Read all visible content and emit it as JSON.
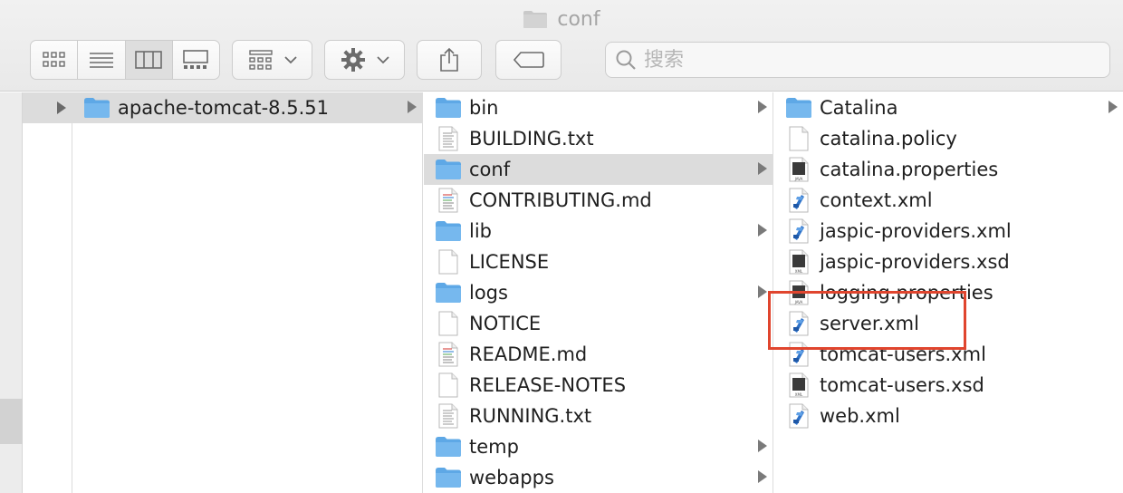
{
  "window": {
    "title": "conf"
  },
  "toolbar": {
    "view_modes": [
      "icon-view",
      "list-view",
      "column-view",
      "gallery-view"
    ],
    "active_view": "column-view",
    "search_placeholder": "搜索"
  },
  "columns": [
    {
      "items": [
        {
          "name": "apache-tomcat-8.5.51",
          "type": "folder",
          "has_children": true,
          "selected": true
        }
      ]
    },
    {
      "items": [
        {
          "name": "bin",
          "type": "folder",
          "has_children": true
        },
        {
          "name": "BUILDING.txt",
          "type": "text"
        },
        {
          "name": "conf",
          "type": "folder",
          "has_children": true,
          "selected": true
        },
        {
          "name": "CONTRIBUTING.md",
          "type": "md"
        },
        {
          "name": "lib",
          "type": "folder",
          "has_children": true
        },
        {
          "name": "LICENSE",
          "type": "blank"
        },
        {
          "name": "logs",
          "type": "folder",
          "has_children": true
        },
        {
          "name": "NOTICE",
          "type": "blank"
        },
        {
          "name": "README.md",
          "type": "md"
        },
        {
          "name": "RELEASE-NOTES",
          "type": "blank"
        },
        {
          "name": "RUNNING.txt",
          "type": "text"
        },
        {
          "name": "temp",
          "type": "folder",
          "has_children": true
        },
        {
          "name": "webapps",
          "type": "folder",
          "has_children": true
        }
      ]
    },
    {
      "items": [
        {
          "name": "Catalina",
          "type": "folder",
          "has_children": true
        },
        {
          "name": "catalina.policy",
          "type": "blank"
        },
        {
          "name": "catalina.properties",
          "type": "java"
        },
        {
          "name": "context.xml",
          "type": "xml"
        },
        {
          "name": "jaspic-providers.xml",
          "type": "xml"
        },
        {
          "name": "jaspic-providers.xsd",
          "type": "xsd"
        },
        {
          "name": "logging.properties",
          "type": "java"
        },
        {
          "name": "server.xml",
          "type": "xml",
          "highlighted": true
        },
        {
          "name": "tomcat-users.xml",
          "type": "xml"
        },
        {
          "name": "tomcat-users.xsd",
          "type": "xsd"
        },
        {
          "name": "web.xml",
          "type": "xml"
        }
      ]
    }
  ],
  "colors": {
    "folder": "#76b8ee",
    "folder_tab": "#5ea8e6",
    "highlight_box": "#e0452e",
    "selection": "#dcdcdc"
  }
}
